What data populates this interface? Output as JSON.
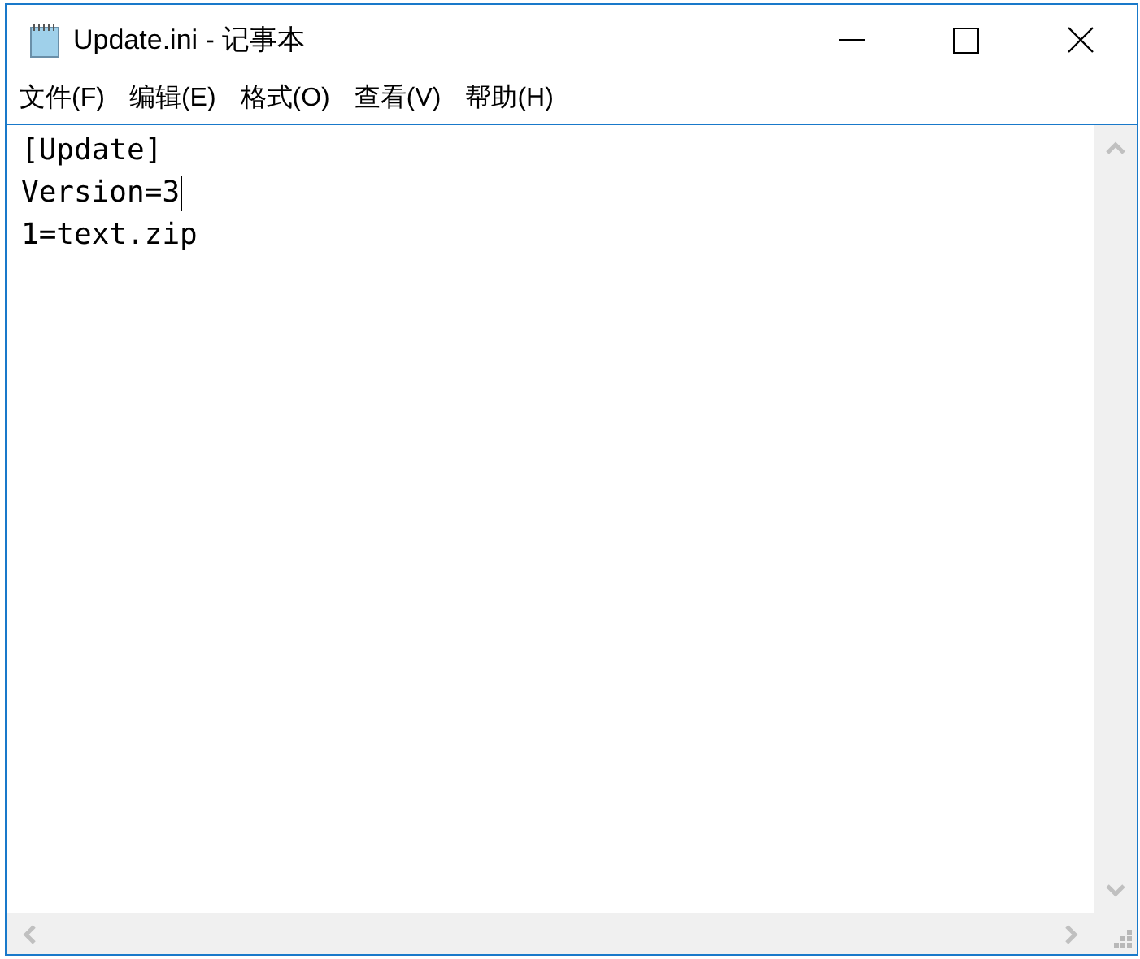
{
  "window": {
    "title": "Update.ini - 记事本"
  },
  "menu": [
    {
      "label": "文件(F)"
    },
    {
      "label": "编辑(E)"
    },
    {
      "label": "格式(O)"
    },
    {
      "label": "查看(V)"
    },
    {
      "label": "帮助(H)"
    }
  ],
  "editor": {
    "lines": [
      {
        "text": "[Update]",
        "caret": false
      },
      {
        "text": "Version=3",
        "caret": true
      },
      {
        "text": "1=text.zip",
        "caret": false
      }
    ]
  }
}
